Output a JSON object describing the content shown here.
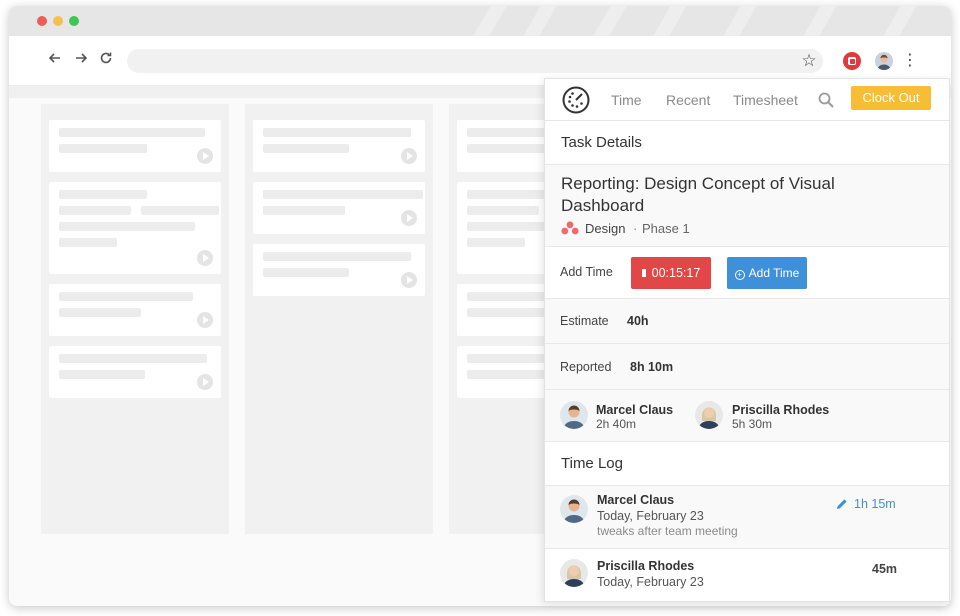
{
  "colors": {
    "close": "#ed5d57",
    "minimize": "#f5bf4f",
    "maximize": "#3fc651",
    "clock_out": "#f7bd35",
    "timer": "#e24646",
    "add_time": "#3f8fd9",
    "asana": "#f06a6a"
  },
  "browser": {
    "icons": [
      "back-arrow-icon",
      "forward-arrow-icon",
      "reload-icon",
      "star-icon",
      "timer-extension-icon",
      "profile-avatar",
      "more-menu-icon"
    ]
  },
  "nav": {
    "tabs": [
      {
        "label": "Time"
      },
      {
        "label": "Recent"
      },
      {
        "label": "Timesheet"
      }
    ],
    "clock_out": "Clock Out"
  },
  "task_details": {
    "heading": "Task Details",
    "title": "Reporting: Design Concept of Visual Dashboard",
    "project": "Design",
    "separator": "·",
    "phase": "Phase 1"
  },
  "add_time": {
    "label": "Add Time",
    "timer": "00:15:17",
    "button": "Add Time"
  },
  "estimate": {
    "label": "Estimate",
    "value": "40h"
  },
  "reported": {
    "label": "Reported",
    "value": "8h 10m"
  },
  "users": [
    {
      "name": "Marcel Claus",
      "time": "2h 40m"
    },
    {
      "name": "Priscilla Rhodes",
      "time": "5h 30m"
    }
  ],
  "time_log": {
    "heading": "Time Log",
    "entries": [
      {
        "name": "Marcel Claus",
        "date": "Today, February 23",
        "note": "tweaks after team meeting",
        "duration": "1h 15m"
      },
      {
        "name": "Priscilla Rhodes",
        "date": "Today, February 23",
        "note": "",
        "duration": "45m"
      }
    ]
  }
}
